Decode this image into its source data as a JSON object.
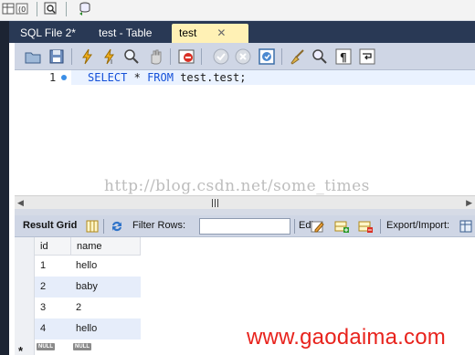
{
  "tabs": [
    {
      "label": "SQL File 2*"
    },
    {
      "label": "test - Table"
    },
    {
      "label": "test",
      "close": "✕"
    }
  ],
  "editor": {
    "line_number": "1",
    "keyword_select": "SELECT",
    "star": "*",
    "keyword_from": "FROM",
    "table": "test.test;"
  },
  "watermark_text": "http://blog.csdn.net/some_times",
  "result_toolbar": {
    "result_grid": "Result Grid",
    "filter_rows": "Filter Rows:",
    "filter_value": "",
    "edit": "Edit:",
    "export_import": "Export/Import:"
  },
  "grid": {
    "columns": [
      "id",
      "name"
    ],
    "rows": [
      {
        "id": "1",
        "name": "hello"
      },
      {
        "id": "2",
        "name": "baby"
      },
      {
        "id": "3",
        "name": "2"
      },
      {
        "id": "4",
        "name": "hello"
      }
    ],
    "null_label": "NULL",
    "new_row_marker": "*"
  },
  "site_watermark": "www.gaodaima.com",
  "colors": {
    "tab_bar": "#293955",
    "active_tab": "#fff1b5",
    "toolbar": "#cfd6e5",
    "keyword": "#1450d8",
    "current_line": "#eaf2ff",
    "site_watermark": "#e8231d"
  }
}
